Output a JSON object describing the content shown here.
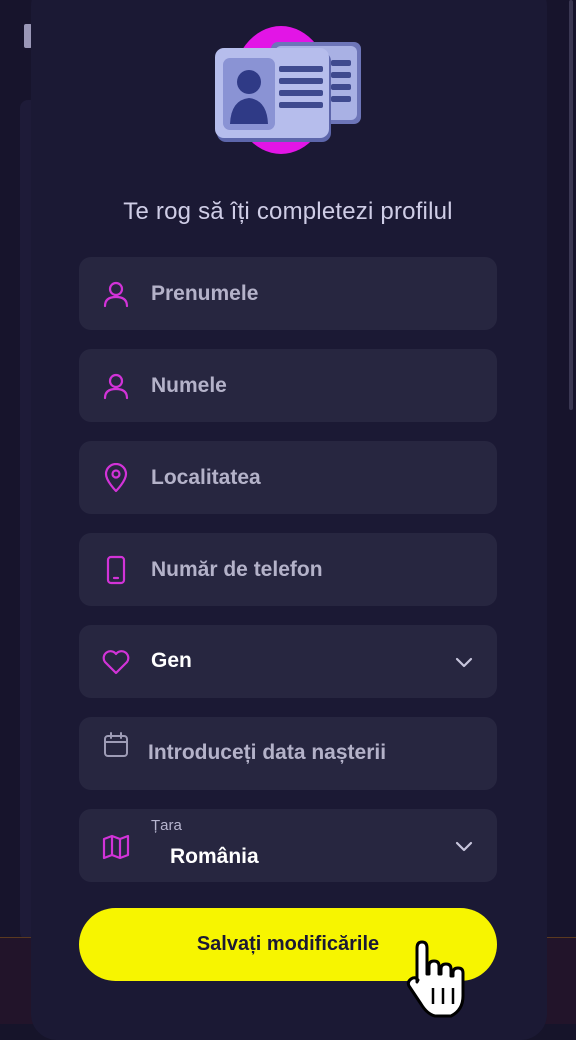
{
  "profile_form": {
    "prompt": "Te rog să îți completezi profilul",
    "first_name": {
      "placeholder": "Prenumele",
      "icon": "user-icon"
    },
    "last_name": {
      "placeholder": "Numele",
      "icon": "user-icon"
    },
    "city": {
      "placeholder": "Localitatea",
      "icon": "location-pin-icon"
    },
    "phone": {
      "placeholder": "Număr de telefon",
      "icon": "phone-icon"
    },
    "gender": {
      "value": "Gen",
      "icon": "heart-icon"
    },
    "birth_date": {
      "placeholder": "Introduceți data nașterii",
      "icon": "calendar-icon"
    },
    "country": {
      "label": "Țara",
      "value": "România",
      "icon": "map-icon"
    },
    "save_label": "Salvați modificările"
  },
  "colors": {
    "accent": "#d233d8",
    "button": "#f7f500",
    "field_bg": "#272640",
    "modal_bg": "#1b1934"
  }
}
